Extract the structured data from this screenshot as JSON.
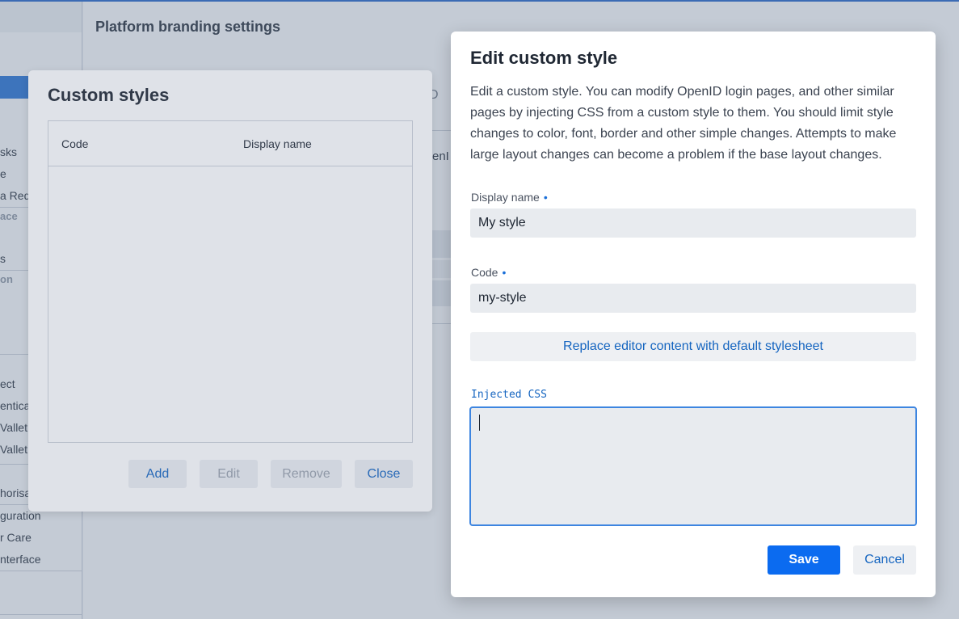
{
  "background": {
    "main_title": "Platform branding settings",
    "fragment_openid_tab": "D",
    "fragment_openid_text": "enI",
    "sidebar_items": [
      "sks",
      "e",
      "a Requ",
      "ace",
      "s",
      "on",
      "ect",
      "enticat",
      "Vallet t",
      "Vallet t",
      "horisa",
      "guration",
      "r Care",
      "nterface"
    ]
  },
  "custom_styles_dialog": {
    "title": "Custom styles",
    "columns": [
      "Code",
      "Display name"
    ],
    "rows": [],
    "buttons": {
      "add": "Add",
      "edit": "Edit",
      "remove": "Remove",
      "close": "Close"
    }
  },
  "edit_dialog": {
    "title": "Edit custom style",
    "description": "Edit a custom style. You can modify OpenID login pages, and other similar pages by injecting CSS from a custom style to them. You should limit style changes to color, font, border and other simple changes. Attempts to make large layout changes can become a problem if the base layout changes.",
    "display_name": {
      "label": "Display name",
      "required_marker": "•",
      "value": "My style"
    },
    "code": {
      "label": "Code",
      "required_marker": "•",
      "value": "my-style"
    },
    "replace_button": "Replace editor content with default stylesheet",
    "injected_css": {
      "label": "Injected CSS",
      "value": ""
    },
    "save_button": "Save",
    "cancel_button": "Cancel"
  },
  "colors": {
    "accent": "#1565c0",
    "primary_button": "#0b6bf0",
    "focus_border": "#3d85e0",
    "required_dot": "#1a6fd8"
  }
}
